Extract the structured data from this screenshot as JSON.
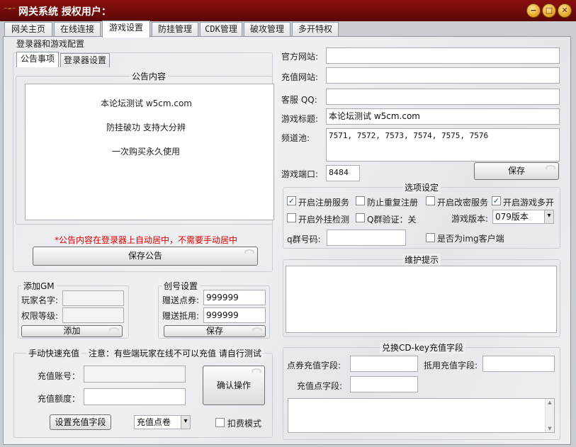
{
  "window": {
    "title": "网关系统  授权用户：",
    "minimize": "−",
    "maximize": "□",
    "close": "✕",
    "logo_icon": "glasses-icon"
  },
  "tabs": [
    "网关主页",
    "在线连接",
    "游戏设置",
    "防挂管理",
    "CDK管理",
    "破攻管理",
    "多开特权"
  ],
  "active_tab": "游戏设置",
  "launcher_group": {
    "title": "登录器和游戏配置",
    "subtabs": [
      "公告事项",
      "登录器设置"
    ],
    "notice_title": "公告内容",
    "notice_lines": [
      "本论坛测试  w5cm.com",
      "防挂破功 支持大分辨",
      "一次购买永久使用"
    ],
    "center_note": "*公告内容在登录器上自动居中，不需要手动居中",
    "save_notice": "保存公告"
  },
  "add_gm": {
    "title": "添加GM",
    "player_label": "玩家名字:",
    "level_label": "权限等级:",
    "player_value": "",
    "level_value": "",
    "add_btn": "添加"
  },
  "create_account": {
    "title": "创号设置",
    "points_label": "赠送点券:",
    "points_value": "999999",
    "voucher_label": "赠送抵用:",
    "voucher_value": "999999",
    "save_btn": "保存"
  },
  "recharge": {
    "title": "手动快速充值",
    "notice": "注意：有些端玩家在线不可以充值 请自行测试",
    "account_label": "充值账号：",
    "amount_label": "充值额度：",
    "account_value": "",
    "amount_value": "",
    "confirm_btn": "确认操作",
    "set_field_btn": "设置充值字段",
    "type_select": "充值点卷",
    "fee_mode": "扣费模式",
    "fee_mode_checked": false
  },
  "site": {
    "official_label": "官方网站:",
    "official_value": "",
    "recharge_label": "充值网站:",
    "recharge_value": "",
    "qq_label": "客服 QQ:",
    "qq_value": "",
    "game_title_label": "游戏标题:",
    "game_title_value": "本论坛测试  w5cm.com",
    "channel_label": "频道池:",
    "channel_value": "7571, 7572, 7573, 7574, 7575, 7576",
    "port_label": "游戏端口:",
    "port_value": "8484",
    "save_btn": "保存"
  },
  "options": {
    "title": "选项设定",
    "items": [
      {
        "label": "开启注册服务",
        "checked": true
      },
      {
        "label": "防止重复注册",
        "checked": false
      },
      {
        "label": "开启改密服务",
        "checked": false
      },
      {
        "label": "开启游戏多开",
        "checked": true
      },
      {
        "label": "开启外挂检测",
        "checked": false
      },
      {
        "label": "Q群验证：关",
        "checked": false
      }
    ],
    "version_label": "游戏版本:",
    "version_value": "079版本",
    "qq_group_label": "q群号码:",
    "qq_group_value": "",
    "img_client_label": "是否为img客户端",
    "img_client_checked": false
  },
  "maintenance": {
    "title": "维护提示"
  },
  "cdkey": {
    "title": "兑换CD-key充值字段",
    "coupon_label": "点券充值字段:",
    "voucher_label": "抵用充值字段:",
    "points_label": "充值点字段:",
    "coupon_value": "",
    "voucher_value": "",
    "points_value": ""
  },
  "icons": {
    "check": "✓",
    "dropdown": "▾",
    "scroll_up": "▲",
    "scroll_down": "▼"
  }
}
